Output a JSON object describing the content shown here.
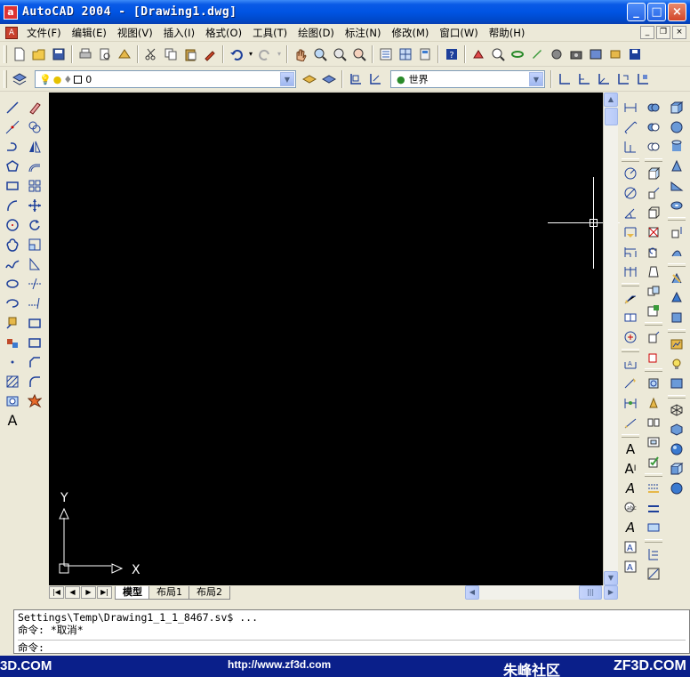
{
  "window": {
    "title": "AutoCAD 2004 - [Drawing1.dwg]",
    "app_icon_letter": "a",
    "minimize": "_",
    "maximize": "□",
    "close": "×"
  },
  "menubar": {
    "items": [
      "文件(F)",
      "编辑(E)",
      "视图(V)",
      "插入(I)",
      "格式(O)",
      "工具(T)",
      "绘图(D)",
      "标注(N)",
      "修改(M)",
      "窗口(W)",
      "帮助(H)"
    ],
    "doc_min": "_",
    "doc_restore": "❐",
    "doc_close": "×"
  },
  "layer_toolbar": {
    "current_layer": "0"
  },
  "ucs_toolbar": {
    "current_ucs": "世界"
  },
  "ucs_icon": {
    "x_label": "X",
    "y_label": "Y"
  },
  "layout_tabs": [
    "模型",
    "布局1",
    "布局2"
  ],
  "command_line": {
    "history": [
      "Settings\\Temp\\Drawing1_1_1_8467.sv$ ...",
      "命令: *取消*"
    ],
    "prompt": "命令:"
  },
  "watermark": {
    "left": "3D.COM",
    "url": "http://www.zf3d.com",
    "cn": "朱峰社区",
    "right": "ZF3D.COM"
  },
  "colors": {
    "titlebar": "#0054e3",
    "drawing_bg": "#000000",
    "chrome": "#ece9d8",
    "watermark_bg": "#0a1f8a"
  }
}
